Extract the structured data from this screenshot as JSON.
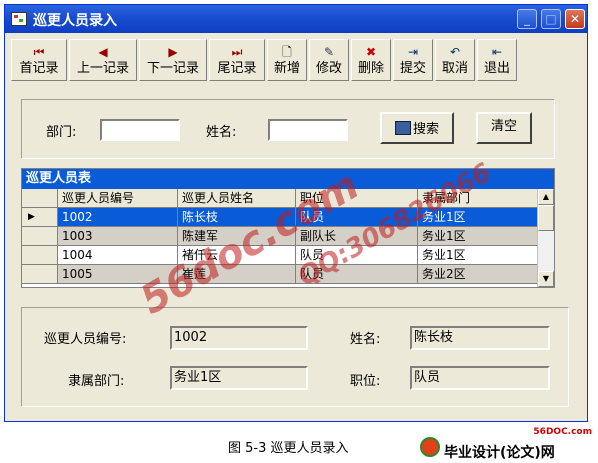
{
  "window": {
    "title": "巡更人员录入",
    "controls": {
      "minimize": "_",
      "maximize": "□",
      "close": "✕"
    }
  },
  "toolbar": [
    {
      "label": "首记录",
      "icon": "first-record-icon",
      "glyph": "⏮"
    },
    {
      "label": "上一记录",
      "icon": "prev-record-icon",
      "glyph": "◀"
    },
    {
      "label": "下一记录",
      "icon": "next-record-icon",
      "glyph": "▶"
    },
    {
      "label": "尾记录",
      "icon": "last-record-icon",
      "glyph": "⏭"
    },
    {
      "label": "新增",
      "icon": "new-document-icon",
      "glyph": "🗋"
    },
    {
      "label": "修改",
      "icon": "edit-icon",
      "glyph": "✎"
    },
    {
      "label": "删除",
      "icon": "delete-icon",
      "glyph": "✖"
    },
    {
      "label": "提交",
      "icon": "submit-icon",
      "glyph": "⇥"
    },
    {
      "label": "取消",
      "icon": "cancel-icon",
      "glyph": "↶"
    },
    {
      "label": "退出",
      "icon": "exit-icon",
      "glyph": "⇤"
    }
  ],
  "search": {
    "department_label": "部门:",
    "department_value": "",
    "name_label": "姓名:",
    "name_value": "",
    "search_button": "搜索",
    "clear_button": "清空"
  },
  "grid": {
    "caption": "巡更人员表",
    "columns": [
      "巡更人员编号",
      "巡更人员姓名",
      "职位",
      "隶属部门"
    ],
    "rows": [
      [
        "1002",
        "陈长枝",
        "队员",
        "务业1区"
      ],
      [
        "1003",
        "陈建军",
        "副队长",
        "务业1区"
      ],
      [
        "1004",
        "褚仟云",
        "队员",
        "务业1区"
      ],
      [
        "1005",
        "崔莲",
        "队员",
        "务业2区"
      ]
    ],
    "selected_row": 0
  },
  "detail": {
    "id_label": "巡更人员编号:",
    "id_value": "1002",
    "name_label": "姓名:",
    "name_value": "陈长枝",
    "dept_label": "隶属部门:",
    "dept_value": "务业1区",
    "position_label": "职位:",
    "position_value": "队员"
  },
  "figure_caption": "图 5-3  巡更人员录入",
  "watermarks": {
    "site": "56doc.com",
    "qq": "QQ:306826066"
  },
  "footer": {
    "site_small": "56DOC.com",
    "brand": "毕业设计(论文)网"
  },
  "colors": {
    "title_bar": "#1a4fd2",
    "grid_caption": "#0a5bd8",
    "selection": "#0a5bd8",
    "window_bg": "#ece9d8"
  }
}
